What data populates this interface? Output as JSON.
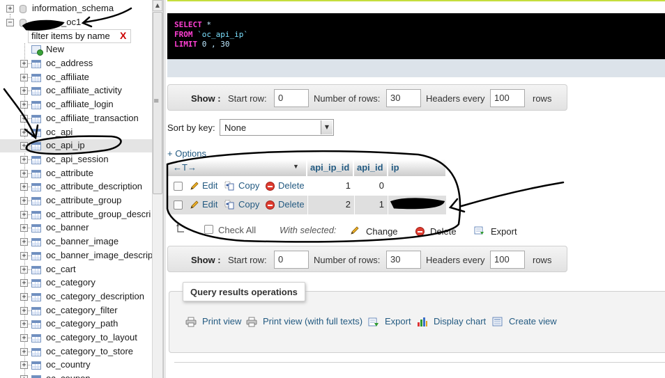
{
  "navigation": {
    "databases": [
      {
        "name": "information_schema",
        "expander": "+"
      },
      {
        "name": "_oc1",
        "expander": "−"
      }
    ],
    "filter_placeholder": "filter items by name",
    "filter_clear": "X",
    "new_label": "New",
    "tables": [
      "oc_address",
      "oc_affiliate",
      "oc_affiliate_activity",
      "oc_affiliate_login",
      "oc_affiliate_transaction",
      "oc_api",
      "oc_api_ip",
      "oc_api_session",
      "oc_attribute",
      "oc_attribute_description",
      "oc_attribute_group",
      "oc_attribute_group_descri",
      "oc_banner",
      "oc_banner_image",
      "oc_banner_image_descrip",
      "oc_cart",
      "oc_category",
      "oc_category_description",
      "oc_category_filter",
      "oc_category_path",
      "oc_category_to_layout",
      "oc_category_to_store",
      "oc_country",
      "oc_coupon"
    ],
    "selected_table": "oc_api_ip",
    "grip": "≡"
  },
  "sql": {
    "line1_kw": "SELECT",
    "line1_rest": " *",
    "line2_kw": "FROM",
    "line2_table": " `oc_api_ip`",
    "line3_kw": "LIMIT",
    "line3_rest": " 0 , 30"
  },
  "paging_top": {
    "show": "Show :",
    "start_row_label": "Start row:",
    "start_row": "0",
    "rows_label": "Number of rows:",
    "rows": "30",
    "headers_label": "Headers every",
    "headers": "100",
    "rows_suffix": "rows"
  },
  "paging_bottom": {
    "show": "Show :",
    "start_row_label": "Start row:",
    "start_row": "0",
    "rows_label": "Number of rows:",
    "rows": "30",
    "headers_label": "Headers every",
    "headers": "100",
    "rows_suffix": "rows"
  },
  "sort": {
    "label": "Sort by key:",
    "value": "None"
  },
  "options_link": "+ Options",
  "table": {
    "arrows": "←T→",
    "columns": [
      "api_ip_id",
      "api_id",
      "ip"
    ],
    "rows": [
      {
        "edit": "Edit",
        "copy": "Copy",
        "delete": "Delete",
        "api_ip_id": "1",
        "api_id": "0",
        "ip": ""
      },
      {
        "edit": "Edit",
        "copy": "Copy",
        "delete": "Delete",
        "api_ip_id": "2",
        "api_id": "1",
        "ip": ""
      }
    ]
  },
  "with_selected": {
    "check_all": "Check All",
    "label": "With selected:",
    "change": "Change",
    "delete": "Delete",
    "export": "Export"
  },
  "query_ops": {
    "title": "Query results operations",
    "print_view": "Print view",
    "print_view_full": "Print view (with full texts)",
    "export": "Export",
    "display_chart": "Display chart",
    "create_view": "Create view"
  }
}
